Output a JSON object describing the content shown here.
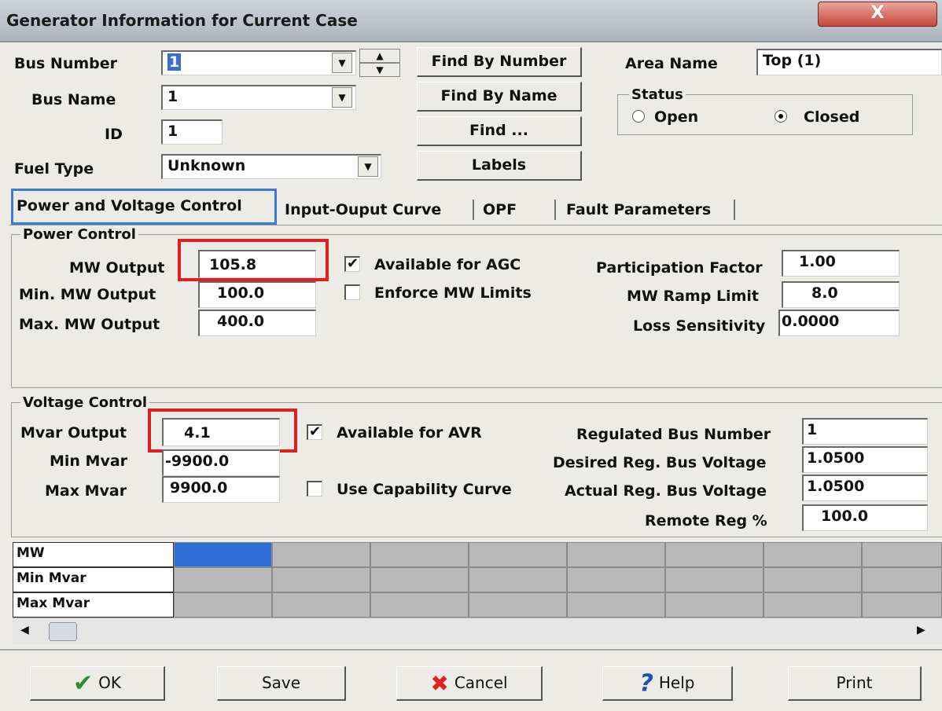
{
  "window": {
    "title": "Generator Information for Current Case",
    "close_glyph": "X"
  },
  "bus": {
    "number_label": "Bus Number",
    "number_value": "1",
    "name_label": "Bus Name",
    "name_value": "1",
    "id_label": "ID",
    "id_value": "1",
    "fuel_label": "Fuel Type",
    "fuel_value": "Unknown"
  },
  "buttons": {
    "find_by_number": "Find By Number",
    "find_by_name": "Find By Name",
    "find": "Find ...",
    "labels": "Labels"
  },
  "area": {
    "label": "Area Name",
    "value": "Top (1)"
  },
  "status": {
    "label": "Status",
    "open": "Open",
    "closed": "Closed",
    "selected": "Closed"
  },
  "tabs": [
    {
      "label": "Power and Voltage Control",
      "active": true
    },
    {
      "label": "Input-Ouput Curve",
      "active": false
    },
    {
      "label": "OPF",
      "active": false
    },
    {
      "label": "Fault Parameters",
      "active": false
    }
  ],
  "power_control": {
    "legend": "Power Control",
    "mw_output_label": "MW Output",
    "mw_output": "105.8",
    "min_mw_label": "Min. MW Output",
    "min_mw": "100.0",
    "max_mw_label": "Max. MW Output",
    "max_mw": "400.0",
    "agc_label": "Available for AGC",
    "agc_checked": true,
    "enforce_label": "Enforce MW Limits",
    "enforce_checked": false,
    "part_factor_label": "Participation Factor",
    "part_factor": "1.00",
    "ramp_label": "MW Ramp Limit",
    "ramp": "8.0",
    "loss_label": "Loss Sensitivity",
    "loss": "0.0000"
  },
  "voltage_control": {
    "legend": "Voltage Control",
    "mvar_output_label": "Mvar Output",
    "mvar_output": "4.1",
    "min_mvar_label": "Min Mvar",
    "min_mvar": "-9900.0",
    "max_mvar_label": "Max Mvar",
    "max_mvar": "9900.0",
    "avr_label": "Available for AVR",
    "avr_checked": true,
    "cap_curve_label": "Use Capability Curve",
    "cap_curve_checked": false,
    "reg_bus_label": "Regulated Bus Number",
    "reg_bus": "1",
    "desired_v_label": "Desired Reg. Bus Voltage",
    "desired_v": "1.0500",
    "actual_v_label": "Actual Reg. Bus Voltage",
    "actual_v": "1.0500",
    "remote_label": "Remote Reg %",
    "remote": "100.0"
  },
  "grid": {
    "rows": [
      "MW",
      "Min Mvar",
      "Max Mvar"
    ]
  },
  "footer": {
    "ok": "OK",
    "save": "Save",
    "cancel": "Cancel",
    "help": "Help",
    "print": "Print"
  },
  "colors": {
    "highlight_box": "#e02020",
    "active_tab_border": "#3b7bd6",
    "selected_cell": "#2f6fd8"
  }
}
